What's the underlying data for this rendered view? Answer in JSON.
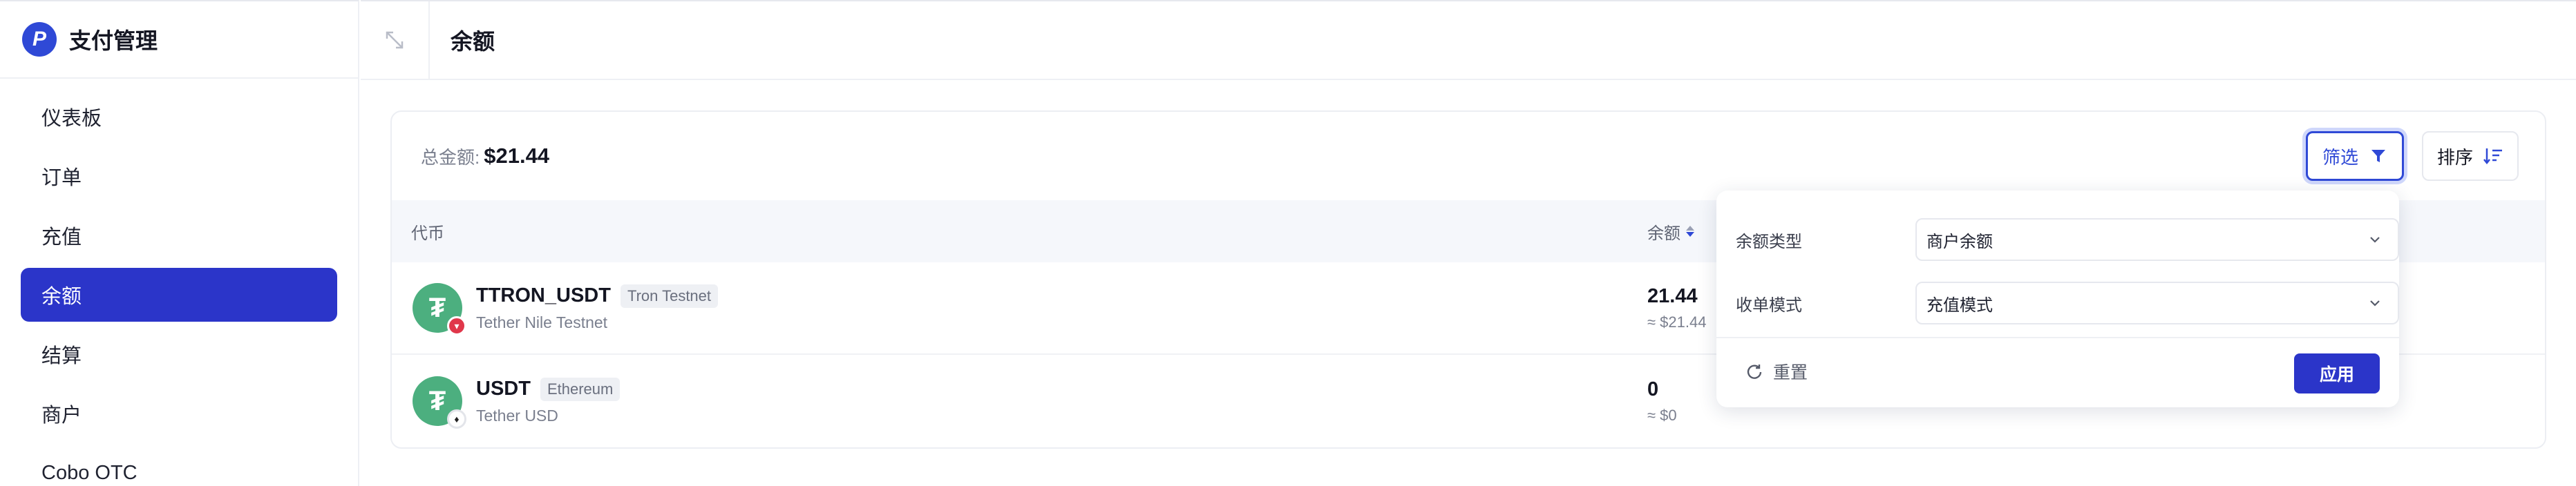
{
  "app": {
    "title": "支付管理",
    "logo_letter": "P"
  },
  "sidebar": {
    "items": [
      {
        "label": "仪表板",
        "active": false
      },
      {
        "label": "订单",
        "active": false
      },
      {
        "label": "充值",
        "active": false
      },
      {
        "label": "余额",
        "active": true
      },
      {
        "label": "结算",
        "active": false
      },
      {
        "label": "商户",
        "active": false
      },
      {
        "label": "Cobo OTC",
        "active": false
      }
    ]
  },
  "header": {
    "page_title": "余额",
    "collapse_icon": "expand-arrows-icon"
  },
  "summary": {
    "total_label": "总金额:",
    "total_value": "$21.44"
  },
  "toolbar": {
    "filter_label": "筛选",
    "sort_label": "排序"
  },
  "table": {
    "columns": {
      "currency": "代币",
      "balance": "余额"
    },
    "rows": [
      {
        "symbol": "TTRON_USDT",
        "network": "Tron Testnet",
        "full_name": "Tether Nile Testnet",
        "balance": "21.44",
        "balance_usd": "≈ $21.44",
        "chain": "tron"
      },
      {
        "symbol": "USDT",
        "network": "Ethereum",
        "full_name": "Tether USD",
        "balance": "0",
        "balance_usd": "≈ $0",
        "chain": "ethereum"
      }
    ]
  },
  "filter_popover": {
    "balance_type_label": "余额类型",
    "balance_type_value": "商户余额",
    "collection_mode_label": "收单模式",
    "collection_mode_value": "充值模式",
    "reset_label": "重置",
    "apply_label": "应用"
  },
  "colors": {
    "accent": "#2b35c9",
    "coin_green": "#4caf7f",
    "tron_red": "#e0374a"
  }
}
